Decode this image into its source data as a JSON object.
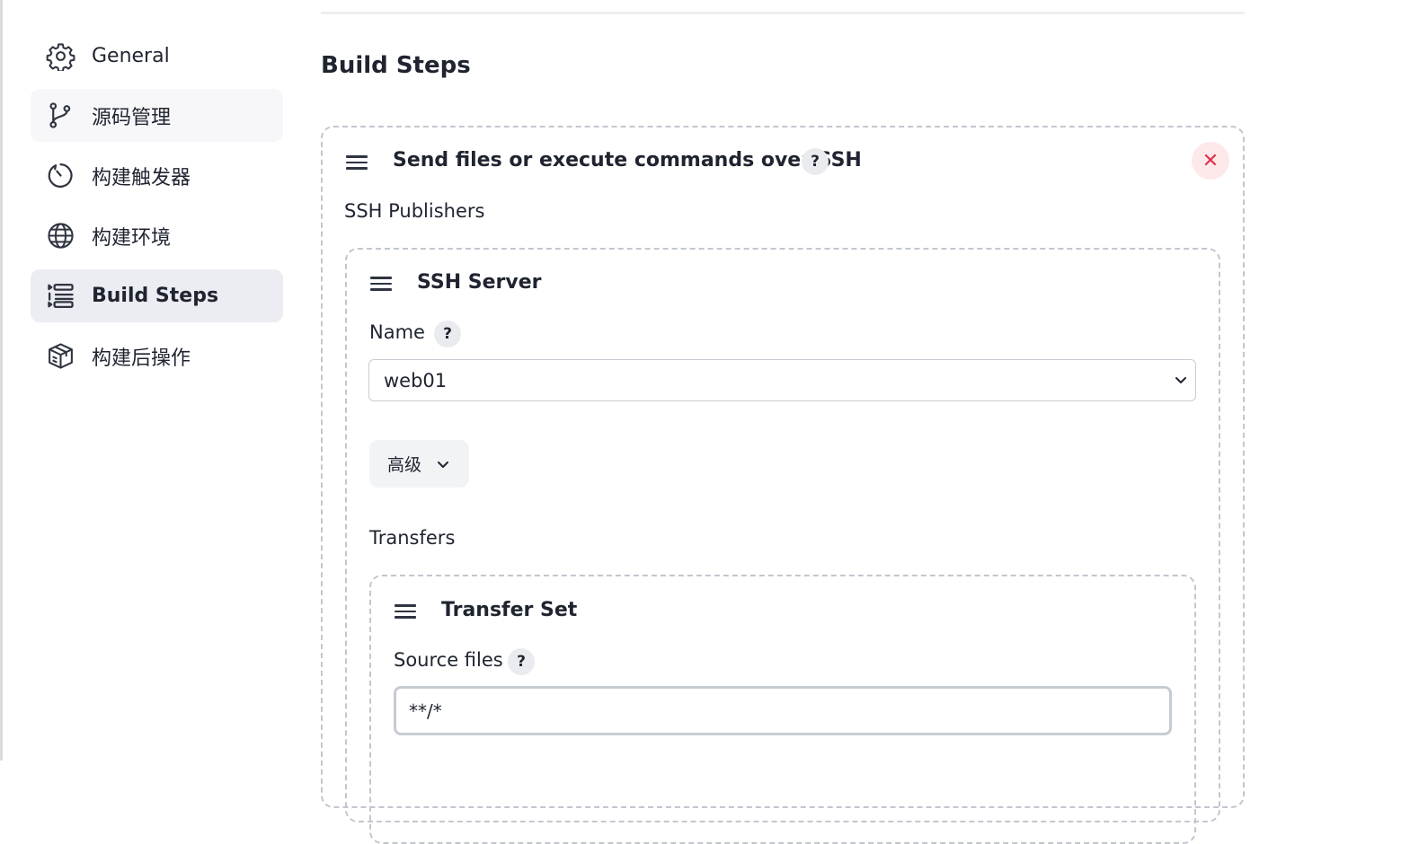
{
  "sidebar": {
    "items": [
      {
        "label": "General",
        "icon": "gear-icon"
      },
      {
        "label": "源码管理",
        "icon": "git-branch-icon"
      },
      {
        "label": "构建触发器",
        "icon": "clock-icon"
      },
      {
        "label": "构建环境",
        "icon": "globe-icon"
      },
      {
        "label": "Build Steps",
        "icon": "list-icon",
        "active": true
      },
      {
        "label": "构建后操作",
        "icon": "package-icon"
      }
    ]
  },
  "main": {
    "title": "Build Steps",
    "step": {
      "title": "Send files or execute commands over SSH",
      "help": "?",
      "close": "✕",
      "publishers_label": "SSH Publishers",
      "server": {
        "title": "SSH Server",
        "name_label": "Name",
        "name_help": "?",
        "name_value": "web01",
        "advanced_label": "高级",
        "transfers_label": "Transfers",
        "transfer_set": {
          "title": "Transfer Set",
          "source_label": "Source files",
          "source_help": "?",
          "source_value": "**/*"
        }
      }
    }
  },
  "colors": {
    "accent_active": "#ebedf2",
    "close_bg": "#fde8ea",
    "close_fg": "#e0314a",
    "dashed_border": "#c2c7ce"
  }
}
